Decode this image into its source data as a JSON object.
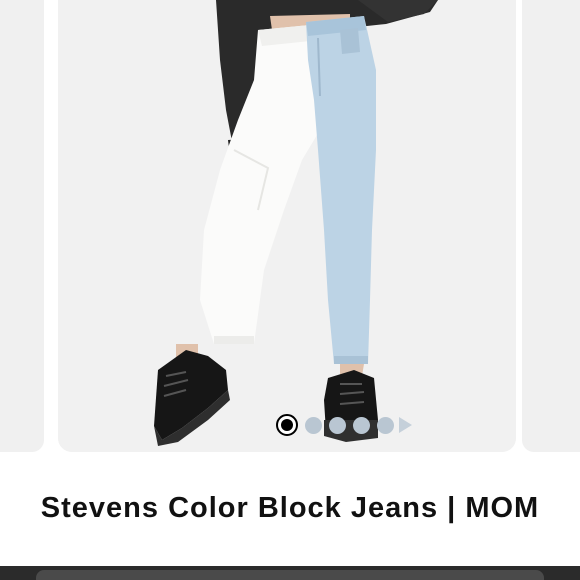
{
  "carousel": {
    "slide_count": 5,
    "active_index": 0
  },
  "product": {
    "title": "Stevens Color Block Jeans | MOM"
  },
  "colors": {
    "card_background": "#f1f1f1",
    "dot_inactive": "#b9c6d2",
    "dot_active": "#000000",
    "title_text": "#111111"
  },
  "icons": {
    "next": "chevron-right-icon"
  }
}
